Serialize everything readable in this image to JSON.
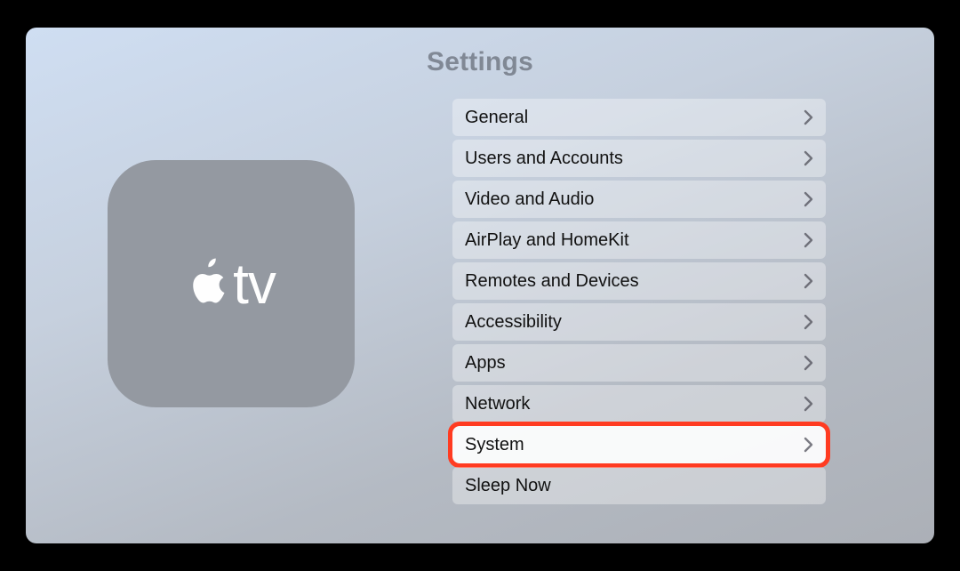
{
  "page_title": "Settings",
  "tile_text": "tv",
  "menu": {
    "items": [
      {
        "label": "General",
        "chevron": true,
        "highlighted": false
      },
      {
        "label": "Users and Accounts",
        "chevron": true,
        "highlighted": false
      },
      {
        "label": "Video and Audio",
        "chevron": true,
        "highlighted": false
      },
      {
        "label": "AirPlay and HomeKit",
        "chevron": true,
        "highlighted": false
      },
      {
        "label": "Remotes and Devices",
        "chevron": true,
        "highlighted": false
      },
      {
        "label": "Accessibility",
        "chevron": true,
        "highlighted": false
      },
      {
        "label": "Apps",
        "chevron": true,
        "highlighted": false
      },
      {
        "label": "Network",
        "chevron": true,
        "highlighted": false
      },
      {
        "label": "System",
        "chevron": true,
        "highlighted": true
      },
      {
        "label": "Sleep Now",
        "chevron": false,
        "highlighted": false
      }
    ]
  },
  "colors": {
    "highlight_ring": "#ff3b21",
    "tile_bg": "#9499a1"
  }
}
